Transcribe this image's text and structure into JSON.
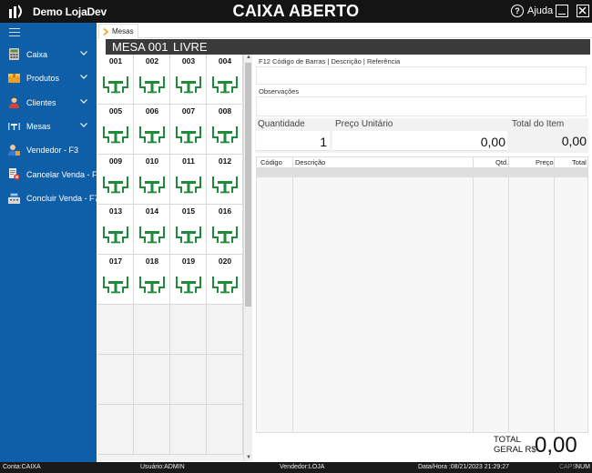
{
  "titlebar": {
    "app_name": "Demo LojaDev",
    "title": "CAIXA ABERTO",
    "help_label": "Ajuda",
    "help_glyph": "?"
  },
  "sidebar": {
    "items": [
      {
        "label": "Caixa",
        "icon": "calculator-icon"
      },
      {
        "label": "Produtos",
        "icon": "box-icon"
      },
      {
        "label": "Clientes",
        "icon": "person-icon"
      },
      {
        "label": "Mesas",
        "icon": "tables-icon"
      },
      {
        "label": "Vendedor - F3",
        "icon": "seller-icon"
      },
      {
        "label": "Cancelar Venda - F6",
        "icon": "cancel-sale-icon"
      },
      {
        "label": "Concluir Venda - F7",
        "icon": "register-icon"
      }
    ]
  },
  "tab": {
    "label": "Mesas"
  },
  "mesa": {
    "number": "MESA 001",
    "status": "LIVRE"
  },
  "tables": [
    "001",
    "002",
    "003",
    "004",
    "005",
    "006",
    "007",
    "008",
    "009",
    "010",
    "011",
    "012",
    "013",
    "014",
    "015",
    "016",
    "017",
    "018",
    "019",
    "020"
  ],
  "form": {
    "barcode_label": "F12 Código de Barras | Descrição | Referência",
    "notes_label": "Observações",
    "qty_label": "Quantidade",
    "qty_value": "1",
    "unit_label": "Preço Unitário",
    "unit_value": "0,00",
    "item_total_label": "Total do Item",
    "item_total_value": "0,00"
  },
  "items_table": {
    "columns": [
      "Código",
      "Descrição",
      "Qtd.",
      "Preço",
      "Total"
    ]
  },
  "total": {
    "label_line1": "TOTAL",
    "label_line2": "GERAL R$",
    "value": "0,00"
  },
  "status": {
    "conta": "Conta:CAIXA",
    "usuario": "Usuário:ADMIN",
    "vendedor": "Vendedor:LOJA",
    "datahora": "Data/Hora :08/21/2023 21:29:27",
    "caps": "CAPS",
    "num": "NUM"
  },
  "colors": {
    "sidebar": "#0e5fa8",
    "table_green": "#1e8a3a",
    "titlebar": "#141414"
  }
}
